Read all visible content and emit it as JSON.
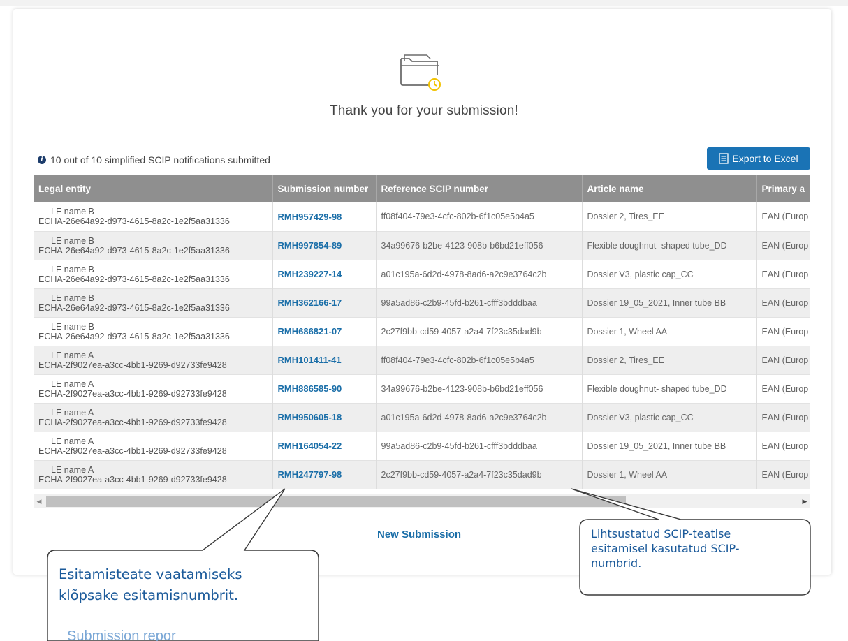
{
  "page": {
    "thank_you": "Thank you for your submission!",
    "summary": "10 out of 10 simplified SCIP notifications submitted",
    "export_label": "Export to Excel",
    "new_submission": "New Submission"
  },
  "table": {
    "headers": [
      "Legal entity",
      "Submission number",
      "Reference SCIP number",
      "Article name",
      "Primary a"
    ],
    "rows": [
      {
        "le_name": "LE name B",
        "le_id": "ECHA-26e64a92-d973-4615-8a2c-1e2f5aa31336",
        "submission": "RMH957429-98",
        "reference": "ff08f404-79e3-4cfc-802b-6f1c05e5b4a5",
        "article": "Dossier 2, Tires_EE",
        "primary": "EAN (Europ"
      },
      {
        "le_name": "LE name B",
        "le_id": "ECHA-26e64a92-d973-4615-8a2c-1e2f5aa31336",
        "submission": "RMH997854-89",
        "reference": "34a99676-b2be-4123-908b-b6bd21eff056",
        "article": "Flexible doughnut- shaped tube_DD",
        "primary": "EAN (Europ"
      },
      {
        "le_name": "LE name B",
        "le_id": "ECHA-26e64a92-d973-4615-8a2c-1e2f5aa31336",
        "submission": "RMH239227-14",
        "reference": "a01c195a-6d2d-4978-8ad6-a2c9e3764c2b",
        "article": "Dossier V3, plastic cap_CC",
        "primary": "EAN (Europ"
      },
      {
        "le_name": "LE name B",
        "le_id": "ECHA-26e64a92-d973-4615-8a2c-1e2f5aa31336",
        "submission": "RMH362166-17",
        "reference": "99a5ad86-c2b9-45fd-b261-cfff3bdddbaa",
        "article": "Dossier 19_05_2021, Inner tube BB",
        "primary": "EAN (Europ"
      },
      {
        "le_name": "LE name B",
        "le_id": "ECHA-26e64a92-d973-4615-8a2c-1e2f5aa31336",
        "submission": "RMH686821-07",
        "reference": "2c27f9bb-cd59-4057-a2a4-7f23c35dad9b",
        "article": "Dossier 1, Wheel AA",
        "primary": "EAN (Europ"
      },
      {
        "le_name": "LE name A",
        "le_id": "ECHA-2f9027ea-a3cc-4bb1-9269-d92733fe9428",
        "submission": "RMH101411-41",
        "reference": "ff08f404-79e3-4cfc-802b-6f1c05e5b4a5",
        "article": "Dossier 2, Tires_EE",
        "primary": "EAN (Europ"
      },
      {
        "le_name": "LE name A",
        "le_id": "ECHA-2f9027ea-a3cc-4bb1-9269-d92733fe9428",
        "submission": "RMH886585-90",
        "reference": "34a99676-b2be-4123-908b-b6bd21eff056",
        "article": "Flexible doughnut- shaped tube_DD",
        "primary": "EAN (Europ"
      },
      {
        "le_name": "LE name A",
        "le_id": "ECHA-2f9027ea-a3cc-4bb1-9269-d92733fe9428",
        "submission": "RMH950605-18",
        "reference": "a01c195a-6d2d-4978-8ad6-a2c9e3764c2b",
        "article": "Dossier V3, plastic cap_CC",
        "primary": "EAN (Europ"
      },
      {
        "le_name": "LE name A",
        "le_id": "ECHA-2f9027ea-a3cc-4bb1-9269-d92733fe9428",
        "submission": "RMH164054-22",
        "reference": "99a5ad86-c2b9-45fd-b261-cfff3bdddbaa",
        "article": "Dossier 19_05_2021, Inner tube BB",
        "primary": "EAN (Europ"
      },
      {
        "le_name": "LE name A",
        "le_id": "ECHA-2f9027ea-a3cc-4bb1-9269-d92733fe9428",
        "submission": "RMH247797-98",
        "reference": "2c27f9bb-cd59-4057-a2a4-7f23c35dad9b",
        "article": "Dossier 1, Wheel AA",
        "primary": "EAN (Europ"
      }
    ]
  },
  "callouts": {
    "left_line1": "Esitamisteate vaatamiseks",
    "left_line2": "klõpsake esitamisnumbrit.",
    "right_line1": "Lihtsustatud SCIP-teatise",
    "right_line2": "esitamisel kasutatud SCIP-",
    "right_line3": "numbrid.",
    "peek_text": "Submission repor"
  },
  "icons": {
    "folder": "folder-clock-icon",
    "info": "info-icon",
    "export": "spreadsheet-icon"
  },
  "colors": {
    "accent": "#1a73b5",
    "link": "#1a6ea8",
    "header_bg": "#8f8f8f",
    "clock": "#f2c200",
    "callout_text": "#1b5a9a"
  }
}
